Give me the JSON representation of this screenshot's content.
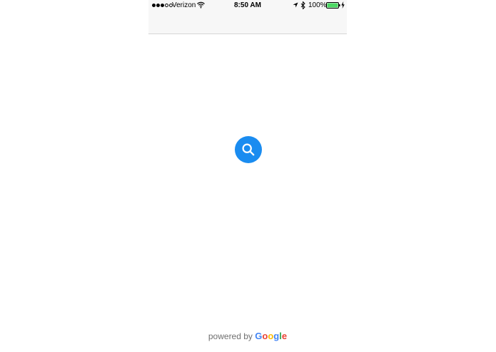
{
  "status_bar": {
    "carrier": "Verizon",
    "time": "8:50 AM",
    "battery_percent": "100%",
    "signal_bars_filled": 3,
    "signal_bars_total": 5,
    "battery_level": 1.0,
    "icons": [
      "wifi-icon",
      "location-icon",
      "bluetooth-icon",
      "battery-icon",
      "charging-icon"
    ]
  },
  "main": {
    "search_button": {
      "icon": "search-icon",
      "color": "#1a8cf0"
    }
  },
  "footer": {
    "powered_by": "powered by",
    "brand": {
      "letters": [
        "G",
        "o",
        "o",
        "g",
        "l",
        "e"
      ]
    }
  },
  "colors": {
    "accent": "#1a8cf0",
    "battery": "#4cd964",
    "nav_background": "#f7f7f7"
  }
}
